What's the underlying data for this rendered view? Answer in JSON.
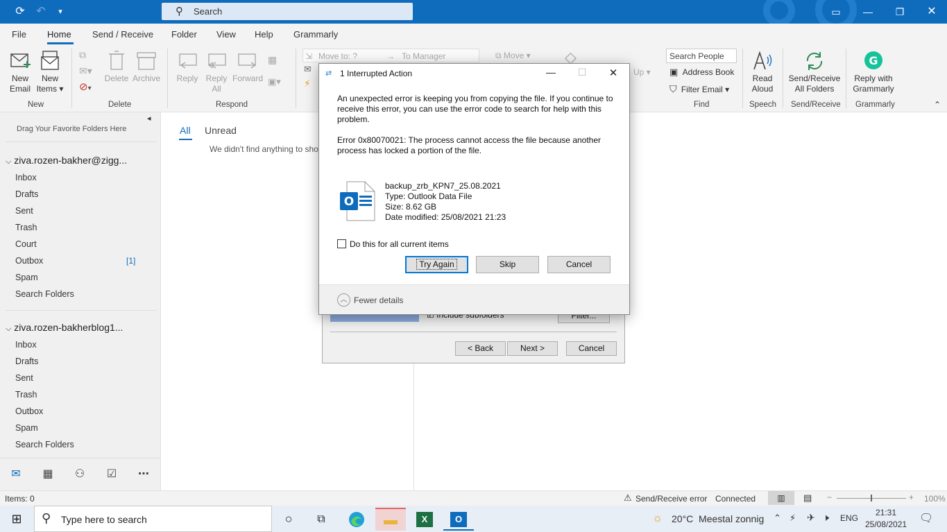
{
  "titlebar": {
    "search_label": "Search"
  },
  "menu": {
    "items": [
      "File",
      "Home",
      "Send / Receive",
      "Folder",
      "View",
      "Help",
      "Grammarly"
    ]
  },
  "ribbon": {
    "new_email": [
      "New",
      "Email"
    ],
    "new_items": [
      "New",
      "Items ▾"
    ],
    "delete": "Delete",
    "archive": "Archive",
    "reply": "Reply",
    "reply_all": [
      "Reply",
      "All"
    ],
    "forward": "Forward",
    "move_to": "Move to: ?",
    "to_manager": "To Manager",
    "move": "Move ▾",
    "up": "Up ▾",
    "search_people_placeholder": "Search People",
    "address_book": "Address Book",
    "filter_email": "Filter Email ▾",
    "read_aloud": [
      "Read",
      "Aloud"
    ],
    "send_receive_all": [
      "Send/Receive",
      "All Folders"
    ],
    "reply_grammarly": [
      "Reply with",
      "Grammarly"
    ],
    "groups": {
      "new": "New",
      "delete": "Delete",
      "respond": "Respond",
      "find": "Find",
      "speech": "Speech",
      "send_receive": "Send/Receive",
      "grammarly": "Grammarly"
    }
  },
  "folder_pane": {
    "drag_hint": "Drag Your Favorite Folders Here",
    "account1": {
      "name": "ziva.rozen-bakher@zigg...",
      "folders": [
        "Inbox",
        "Drafts",
        "Sent",
        "Trash",
        "Court",
        "Outbox",
        "Spam",
        "Search Folders"
      ],
      "outbox_count": "[1]"
    },
    "account2": {
      "name": "ziva.rozen-bakherblog1...",
      "folders": [
        "Inbox",
        "Drafts",
        "Sent",
        "Trash",
        "Outbox",
        "Spam",
        "Search Folders"
      ]
    }
  },
  "message_list": {
    "tab_all": "All",
    "tab_unread": "Unread",
    "empty_text": "We didn't find anything to sho"
  },
  "wizard": {
    "include_subfolders": "Include subfolders",
    "filter": "Filter...",
    "back": "< Back",
    "next": "Next >",
    "cancel": "Cancel"
  },
  "dialog": {
    "title": "1 Interrupted Action",
    "message": "An unexpected error is keeping you from copying the file. If you continue to receive this error, you can use the error code to search for help with this problem.",
    "error": "Error 0x80070021: The process cannot access the file because another process has locked a portion of the file.",
    "file_name": "backup_zrb_KPN7_25.08.2021",
    "file_type": "Type: Outlook Data File",
    "file_size": "Size: 8.62 GB",
    "file_modified": "Date modified: 25/08/2021 21:23",
    "checkbox_label": "Do this for all current items",
    "btn_try_again": "Try Again",
    "btn_skip": "Skip",
    "btn_cancel": "Cancel",
    "fewer_details": "Fewer details"
  },
  "statusbar": {
    "items": "Items: 0",
    "send_receive_error": "Send/Receive error",
    "connected": "Connected",
    "zoom": "100%"
  },
  "taskbar": {
    "search_placeholder": "Type here to search",
    "weather": "20°C  Meestal zonnig",
    "lang": "ENG",
    "time": "21:31",
    "date": "25/08/2021"
  },
  "colors": {
    "accent": "#0f6cbd",
    "outlook_blue": "#0f6cbd",
    "excel_green": "#1d7044",
    "grammarly_green": "#15c39a"
  }
}
